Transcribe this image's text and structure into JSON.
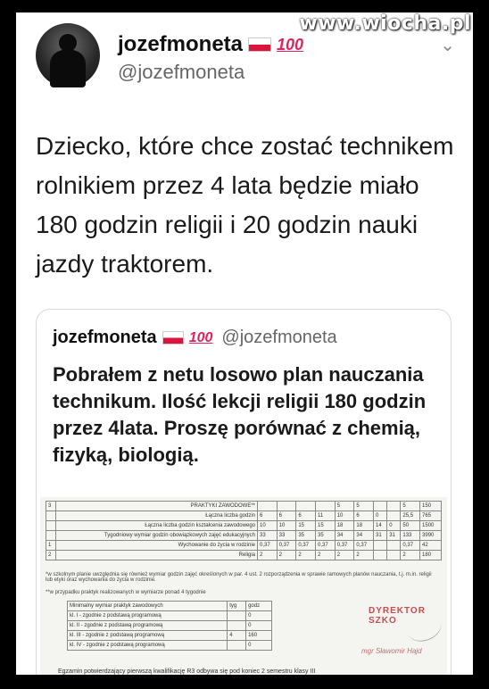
{
  "watermark": "www.wiocha.pl",
  "tweet": {
    "name": "jozefmoneta",
    "hundred": "100",
    "handle": "@jozefmoneta",
    "text": "Dziecko, które chce zostać technikem rolnikiem przez 4 lata będzie miało 180 godzin religii i 20 godzin nauki jazdy traktorem."
  },
  "quoted": {
    "name": "jozefmoneta",
    "hundred": "100",
    "handle": "@jozefmoneta",
    "text": "Pobrałem z netu losowo plan nauczania technikum. Ilość lekcji religii 180 godzin przez 4lata. Proszę porównać z chemią, fizyką, biologią."
  },
  "document": {
    "rows": [
      [
        "3",
        "PRAKTYKI ZAWODOWE**",
        "",
        "",
        "",
        "",
        "5",
        "5",
        "",
        "",
        "5",
        "150"
      ],
      [
        "",
        "Łączna liczba godzin",
        "6",
        "6",
        "6",
        "11",
        "10",
        "6",
        "0",
        "",
        "25,5",
        "765"
      ],
      [
        "",
        "Łączna liczba godzin kształcenia zawodowego",
        "10",
        "10",
        "15",
        "15",
        "18",
        "18",
        "14",
        "0",
        "50",
        "1500"
      ],
      [
        "",
        "Tygodniowy wymiar godzin obowiązkowych zajęć edukacyjnych",
        "33",
        "33",
        "35",
        "35",
        "34",
        "34",
        "31",
        "31",
        "133",
        "3990"
      ],
      [
        "1",
        "Wychowanie do życia w rodzinie",
        "0,37",
        "0,37",
        "0,37",
        "0,37",
        "0,37",
        "0,37",
        "",
        "",
        "0,37",
        "42"
      ],
      [
        "2",
        "Religia",
        "2",
        "2",
        "2",
        "2",
        "2",
        "2",
        "",
        "",
        "2",
        "180"
      ]
    ],
    "note1": "*w szkolnym planie uwzględnia się również wymiar godzin zajęć określonych w par. 4 ust. 2 rozporządzenia w sprawie ramowych planów nauczania, t.j. m.in. religii lub etyki oraz wychowania do życia w rodzinie.",
    "note2": "**w przypadku praktyk realizowanych w wymiarze ponad 4 tygodnie",
    "small_header": [
      "Minimalny wymiar praktyk zawodowych",
      "tyg",
      "godz"
    ],
    "small_rows": [
      [
        "kl. I - zgodnie z podstawą programową",
        "",
        "0"
      ],
      [
        "kl. II - zgodnie z podstawą programową",
        "",
        "0"
      ],
      [
        "kl. III - zgodnie z podstawą programową",
        "4",
        "160"
      ],
      [
        "kl. IV - zgodnie z podstawą programową",
        "",
        "0"
      ]
    ],
    "stamp": "DYREKTOR SZKO",
    "signature": "mgr Sławomir Hajd",
    "footer": "Egzamin potwierdzający pierwszą kwalifikację R3 odbywa się pod koniec 2 semestru klasy III"
  }
}
